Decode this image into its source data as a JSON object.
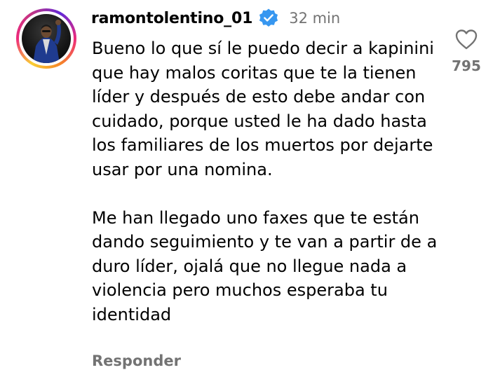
{
  "comment": {
    "username": "ramontolentino_01",
    "verified": true,
    "time": "32 min",
    "paragraphs": [
      "Bueno lo que sí le puedo decir a kapinini que hay malos coritas que te la tienen líder y después de esto debe andar con cuidado, porque usted le ha dado hasta los familiares de los muertos por dejarte usar por una nomina.",
      "Me han llegado uno faxes que te están dando seguimiento y te van a partir de a duro líder, ojalá que no llegue nada a violencia pero muchos esperaba tu identidad"
    ],
    "reply_label": "Responder",
    "like_icon": "heart-outline-icon",
    "like_count": "795"
  },
  "colors": {
    "text": "#000000",
    "muted": "#737373",
    "verified_badge": "#3797f0"
  }
}
